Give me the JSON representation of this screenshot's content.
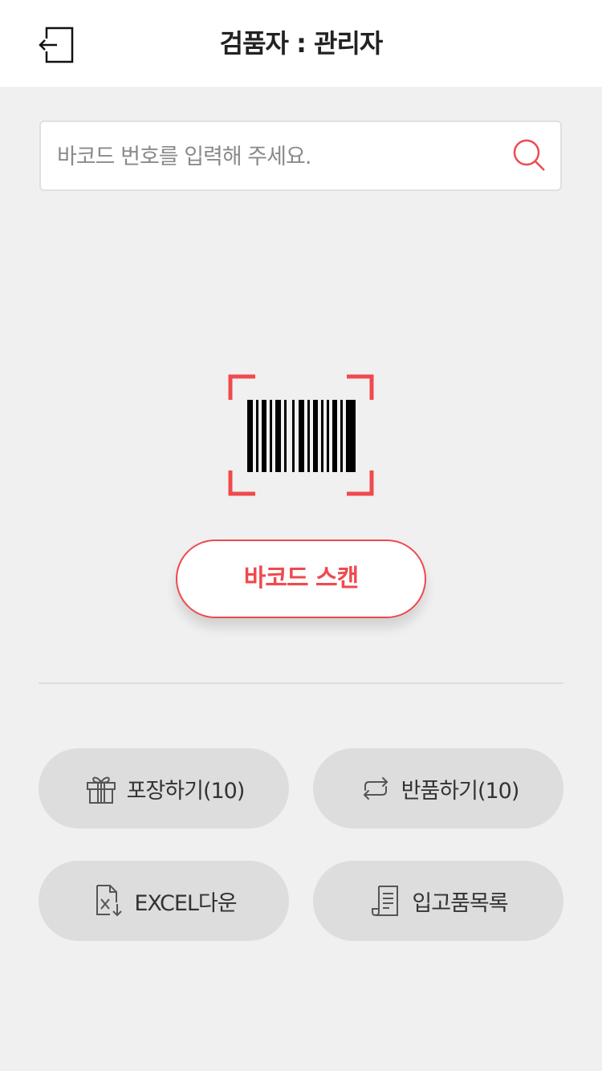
{
  "header": {
    "title": "검품자 : 관리자",
    "logout_icon": "logout-icon"
  },
  "search": {
    "placeholder": "바코드 번호를 입력해 주세요.",
    "value": "",
    "icon": "search-icon"
  },
  "scanner": {
    "icon": "barcode-icon",
    "accent_color": "#ef4a4e",
    "button_label": "바코드 스캔"
  },
  "actions": [
    {
      "label": "포장하기(10)",
      "icon": "gift-icon"
    },
    {
      "label": "반품하기(10)",
      "icon": "return-arrows-icon"
    },
    {
      "label": "EXCEL다운",
      "icon": "excel-download-icon"
    },
    {
      "label": "입고품목록",
      "icon": "document-list-icon"
    }
  ]
}
